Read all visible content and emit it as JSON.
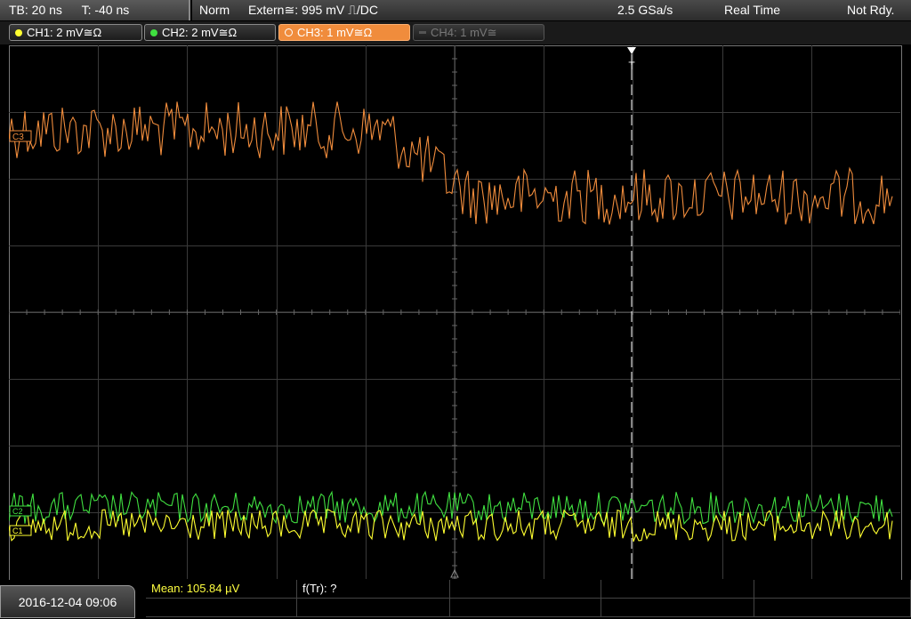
{
  "header": {
    "timebase": "TB: 20 ns",
    "trigger_time": "T: -40 ns",
    "trigger_mode": "Norm",
    "trigger_source": "Extern≅: 995 mV ⎍/DC",
    "sample_rate": "2.5 GSa/s",
    "acq_mode": "Real Time",
    "status": "Not Rdy."
  },
  "channels": [
    {
      "label": "CH1: 2 mV≅Ω",
      "color": "#ffff30"
    },
    {
      "label": "CH2: 2 mV≅Ω",
      "color": "#40e040"
    },
    {
      "label": "CH3: 1 mV≅Ω",
      "color": "#f08c3c"
    },
    {
      "label": "CH4: 1 mV≅",
      "color": "#808080"
    }
  ],
  "markers": {
    "ch3": "C3",
    "ch2": "C2",
    "ch1": "C1",
    "trigger": "T"
  },
  "footer": {
    "datetime": "2016-12-04 09:06",
    "mean": "Mean: 105.84 µV",
    "freq": "f(Tr): ?"
  }
}
